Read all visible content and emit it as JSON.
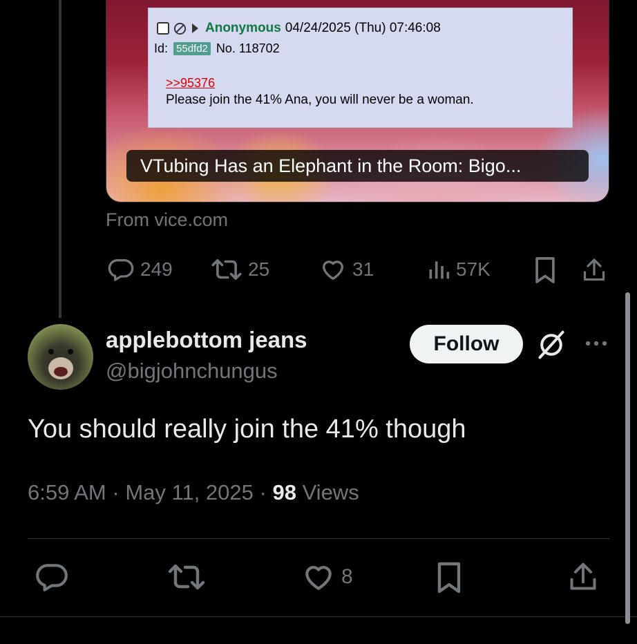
{
  "link_card": {
    "embedded_post": {
      "name": "Anonymous",
      "datetime": "04/24/2025 (Thu) 07:46:08",
      "id_label": "Id:",
      "id_value": "55dfd2",
      "post_number": "No. 118702",
      "quote_link": ">>95376",
      "message": "Please join the 41% Ana, you will never be a woman."
    },
    "title": "VTubing Has an Elephant in the Room: Bigo...",
    "source": "From vice.com"
  },
  "parent_metrics": {
    "replies": "249",
    "reposts": "25",
    "likes": "31",
    "views": "57K"
  },
  "reply": {
    "display_name": "applebottom jeans",
    "handle": "@bigjohnchungus",
    "follow_label": "Follow",
    "text": "You should really join the 41% though",
    "time": "6:59 AM",
    "date": "May 11, 2025",
    "separator": "·",
    "views_count": "98",
    "views_label": "Views",
    "likes": "8"
  },
  "colors": {
    "background": "#000000",
    "text_primary": "#e7e9ea",
    "text_secondary": "#71767b",
    "divider": "#2f3336",
    "follow_bg": "#eff3f4"
  },
  "icons": [
    "reply-icon",
    "repost-icon",
    "like-icon",
    "views-icon",
    "bookmark-icon",
    "share-icon",
    "grok-icon",
    "more-icon"
  ]
}
